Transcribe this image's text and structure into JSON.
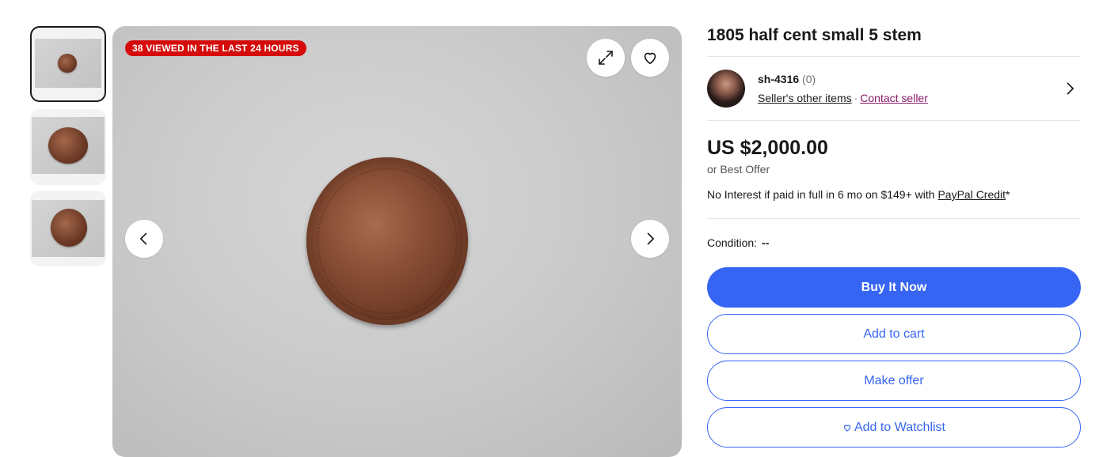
{
  "listing": {
    "title": "1805 half cent small 5 stem",
    "viewed_badge": "38 VIEWED IN THE LAST 24 HOURS",
    "seller": {
      "name": "sh-4316",
      "feedback": "(0)",
      "other_items_link": "Seller's other items",
      "separator": "·",
      "contact_link": "Contact seller"
    },
    "price": "US $2,000.00",
    "best_offer": "or Best Offer",
    "financing": {
      "text": "No Interest if paid in full in 6 mo on $149+ with ",
      "link": "PayPal Credit",
      "suffix": "*"
    },
    "condition": {
      "label": "Condition:",
      "value": "--"
    }
  },
  "buttons": {
    "buy_now": "Buy It Now",
    "add_to_cart": "Add to cart",
    "make_offer": "Make offer",
    "add_to_watchlist": "Add to Watchlist"
  },
  "icons": {
    "expand": "expand-icon",
    "favorite": "heart-icon",
    "prev": "chevron-left-icon",
    "next": "chevron-right-icon",
    "seller": "chevron-right-icon"
  },
  "colors": {
    "primary": "#3665f3",
    "badge": "#d50b0b",
    "contact_link": "#8b1a6b"
  }
}
